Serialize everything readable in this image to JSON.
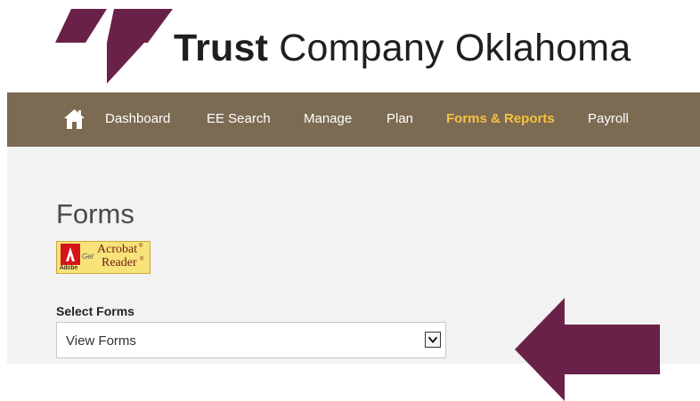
{
  "brand": {
    "name_bold": "Trust",
    "name_rest": " Company Oklahoma",
    "logo_icon": "tco-logo-icon",
    "logo_color": "#6a2149"
  },
  "nav": {
    "home_icon": "home-icon",
    "items": [
      {
        "label": "Dashboard"
      },
      {
        "label": "EE Search"
      },
      {
        "label": "Manage"
      },
      {
        "label": "Plan"
      },
      {
        "label": "Forms & Reports",
        "active": true
      },
      {
        "label": "Payroll"
      }
    ],
    "background": "#7c6b53",
    "active_color": "#f4c23f"
  },
  "page": {
    "title": "Forms"
  },
  "acrobat_badge": {
    "adobe": "Adobe",
    "get": "Get",
    "acrobat": "Acrobat",
    "reader": "Reader",
    "reg": "®"
  },
  "forms": {
    "label": "Select Forms",
    "selected": "View Forms"
  },
  "callout": {
    "icon": "left-arrow-icon",
    "color": "#6a2149"
  }
}
